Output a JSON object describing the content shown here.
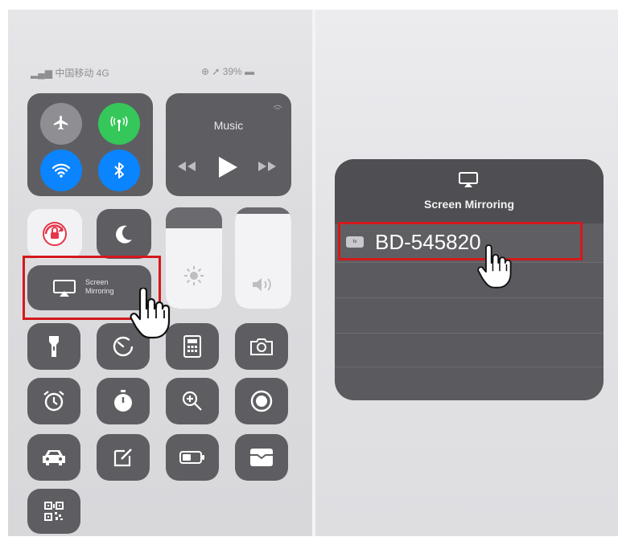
{
  "left": {
    "status": {
      "carrier": "中国移动 4G",
      "battery": "39%"
    },
    "music": {
      "label": "Music"
    },
    "screen_mirroring": {
      "line1": "Screen",
      "line2": "Mirroring"
    }
  },
  "right": {
    "title": "Screen Mirroring",
    "device": {
      "badge": "tv",
      "name": "BD-545820"
    }
  },
  "colors": {
    "highlight": "#d4181b",
    "tile": "#5e5e62",
    "green": "#35c759",
    "blue": "#0a84ff"
  }
}
